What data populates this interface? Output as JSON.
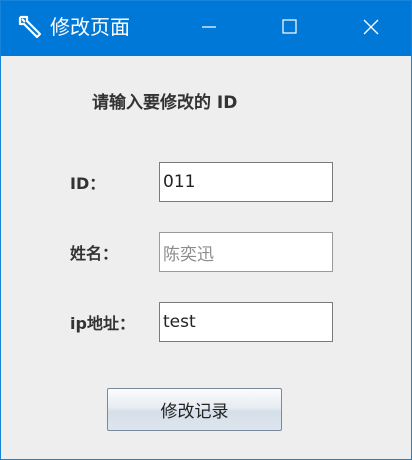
{
  "window": {
    "title": "修改页面",
    "icon": "wrench-icon",
    "controls": [
      "minimize-icon",
      "maximize-icon",
      "close-icon"
    ]
  },
  "form": {
    "prompt": "请输入要修改的 ID",
    "id_label": "ID：",
    "id_value": "011",
    "name_label": "姓名：",
    "name_value": "陈奕迅",
    "ip_label": "ip地址：",
    "ip_value": "test",
    "submit_label": "修改记录"
  },
  "colors": {
    "titlebar": "#0078d7",
    "background": "#eeeeee"
  }
}
